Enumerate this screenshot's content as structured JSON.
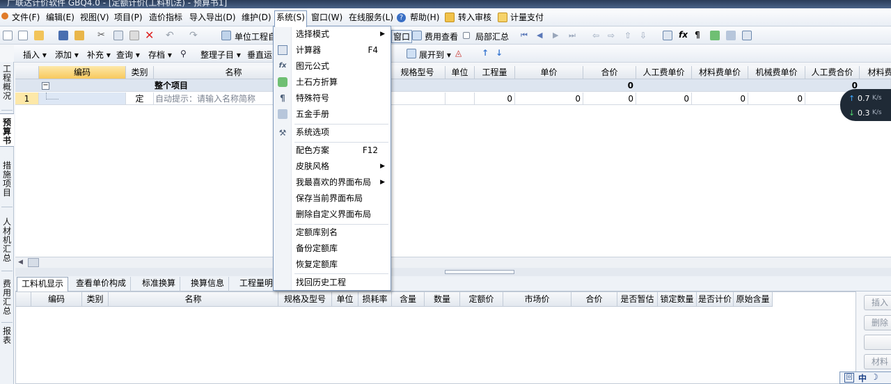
{
  "window": {
    "title": "广联达计价软件 GBQ4.0 - [定额计价(工料机法) - 预算书1]"
  },
  "menubar": {
    "items": [
      {
        "label": "文件(F)"
      },
      {
        "label": "编辑(E)"
      },
      {
        "label": "视图(V)"
      },
      {
        "label": "项目(P)"
      },
      {
        "label": "造价指标"
      },
      {
        "label": "导入导出(D)"
      },
      {
        "label": "维护(D)"
      },
      {
        "label": "系统(S)"
      },
      {
        "label": "窗口(W)"
      },
      {
        "label": "在线服务(L)"
      },
      {
        "label": "帮助(H)"
      },
      {
        "label": "转入审核"
      },
      {
        "label": "计量支付"
      }
    ]
  },
  "toolbar1": {
    "unit_project": "单位工程自",
    "window_btn": "窗口",
    "fee_view": "费用查看",
    "partial_sum": "局部汇总"
  },
  "toolbar2": {
    "insert": "插入",
    "add": "添加",
    "supplement": "补充",
    "query": "查询",
    "archive": "存档",
    "organize": "整理子目",
    "vertical": "垂直运",
    "expand_to": "展开到"
  },
  "left_tabs": [
    "工程概况",
    "预算书",
    "措施项目",
    "人材机汇总",
    "费用汇总",
    "报表"
  ],
  "grid": {
    "headers": [
      "编码",
      "类别",
      "名称",
      "规格型号",
      "单位",
      "工程量",
      "单价",
      "合价",
      "人工费单价",
      "材料费单价",
      "机械费单价",
      "人工费合价",
      "材料费"
    ],
    "group_row": {
      "label": "整个项目",
      "total": "0",
      "labor_total": "0"
    },
    "row1": {
      "num": "1",
      "type": "定",
      "name_hint": "自动提示：请输入名称简称",
      "qty": "0",
      "price": "0",
      "total": "0",
      "labor_price": "0",
      "material_price": "0",
      "machine_price": "0"
    }
  },
  "bottom_tabs": [
    "工料机显示",
    "查看单价构成",
    "标准换算",
    "换算信息",
    "工程量明"
  ],
  "lower_grid": {
    "headers": [
      "编码",
      "类别",
      "名称",
      "规格及型号",
      "单位",
      "损耗率",
      "含量",
      "数量",
      "定额价",
      "市场价",
      "合价",
      "是否暂估",
      "锁定数量",
      "是否计价",
      "原始含量"
    ]
  },
  "right_buttons": [
    "插入",
    "删除",
    "",
    "材料"
  ],
  "system_menu": {
    "items": [
      {
        "label": "选择模式",
        "submenu": true
      },
      {
        "label": "计算器",
        "shortcut": "F4",
        "icon": "calculator-icon"
      },
      {
        "label": "图元公式",
        "icon": "formula-icon"
      },
      {
        "label": "土石方折算",
        "icon": "cube-icon"
      },
      {
        "label": "特殊符号",
        "icon": "pilcrow-icon"
      },
      {
        "label": "五金手册",
        "icon": "handbook-icon"
      },
      {
        "label": "系统选项",
        "icon": "tools-icon"
      },
      {
        "label": "配色方案",
        "shortcut": "F12"
      },
      {
        "label": "皮肤风格",
        "submenu": true
      },
      {
        "label": "我最喜欢的界面布局",
        "submenu": true
      },
      {
        "label": "保存当前界面布局"
      },
      {
        "label": "删除自定义界面布局"
      },
      {
        "label": "定额库别名"
      },
      {
        "label": "备份定额库"
      },
      {
        "label": "恢复定额库"
      },
      {
        "label": "找回历史工程"
      }
    ]
  },
  "net_speed": {
    "up": "0.7",
    "down": "0.3",
    "unit": "K/s"
  },
  "ime": {
    "label": "中"
  },
  "colors": {
    "accent": "#7e99bd",
    "header_selected": "#f8c95d",
    "speed_bg": "#1f2a36"
  }
}
